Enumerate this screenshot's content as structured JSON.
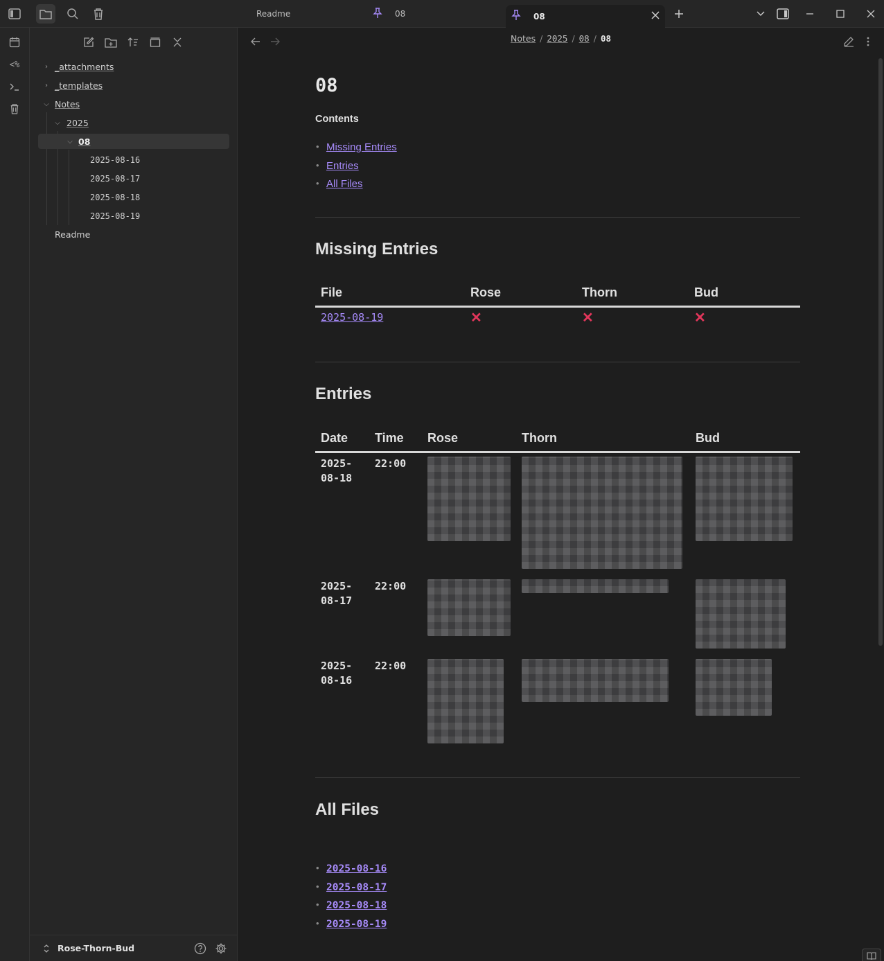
{
  "tabs": [
    {
      "label": "Readme",
      "pinned": false,
      "active": false
    },
    {
      "label": "08",
      "pinned": true,
      "active": false
    },
    {
      "label": "08",
      "pinned": true,
      "active": true
    }
  ],
  "sidebar": {
    "tree": [
      {
        "label": "_attachments",
        "level": 0,
        "type": "folder",
        "expanded": false
      },
      {
        "label": "_templates",
        "level": 0,
        "type": "folder",
        "expanded": false
      },
      {
        "label": "Notes",
        "level": 0,
        "type": "folder",
        "expanded": true
      },
      {
        "label": "2025",
        "level": 1,
        "type": "folder",
        "expanded": true
      },
      {
        "label": "08",
        "level": 2,
        "type": "folder",
        "expanded": true,
        "selected": true
      },
      {
        "label": "2025-08-16",
        "level": 3,
        "type": "file"
      },
      {
        "label": "2025-08-17",
        "level": 3,
        "type": "file"
      },
      {
        "label": "2025-08-18",
        "level": 3,
        "type": "file"
      },
      {
        "label": "2025-08-19",
        "level": 3,
        "type": "file"
      },
      {
        "label": "Readme",
        "level": 0,
        "type": "file"
      }
    ],
    "vault_name": "Rose-Thorn-Bud"
  },
  "breadcrumb": [
    "Notes",
    "2025",
    "08",
    "08"
  ],
  "doc": {
    "title": "08",
    "contents_label": "Contents",
    "contents": [
      "Missing Entries",
      "Entries",
      "All Files"
    ],
    "missing": {
      "heading": "Missing Entries",
      "columns": [
        "File",
        "Rose",
        "Thorn",
        "Bud"
      ],
      "rows": [
        {
          "file": "2025-08-19",
          "rose": "✕",
          "thorn": "✕",
          "bud": "✕"
        }
      ]
    },
    "entries": {
      "heading": "Entries",
      "columns": [
        "Date",
        "Time",
        "Rose",
        "Thorn",
        "Bud"
      ],
      "rows": [
        {
          "date": "2025-08-18",
          "time": "22:00"
        },
        {
          "date": "2025-08-17",
          "time": "22:00"
        },
        {
          "date": "2025-08-16",
          "time": "22:00"
        }
      ]
    },
    "all_files": {
      "heading": "All Files",
      "items": [
        "2025-08-16",
        "2025-08-17",
        "2025-08-18",
        "2025-08-19"
      ]
    }
  },
  "colors": {
    "accent": "#a78bfa",
    "missing_mark": "#e3365b",
    "background": "#1e1e1e",
    "sidebar": "#262626"
  }
}
